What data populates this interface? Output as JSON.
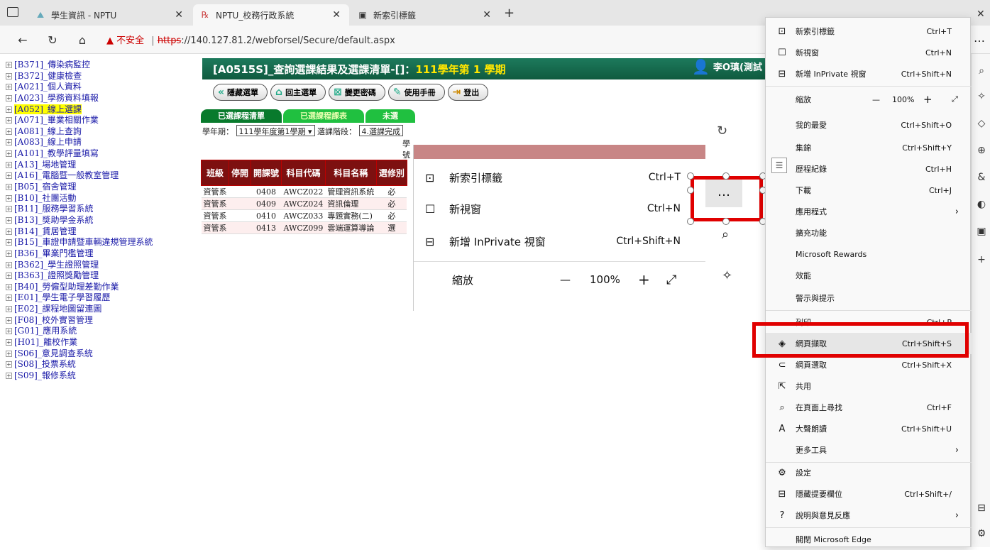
{
  "tabs": [
    {
      "label": "學生資訊 - NPTU",
      "icon": "⛰"
    },
    {
      "label": "NPTU_校務行政系統",
      "icon": "℞"
    },
    {
      "label": "新索引標籤",
      "icon": "▣"
    }
  ],
  "address": {
    "warning": "▲ 不安全",
    "sep": "|",
    "scheme": "https",
    "rest": "://140.127.81.2/webforsel/Secure/default.aspx"
  },
  "tree": [
    "[B371]_傳染病監控",
    "[B372]_健康檢查",
    "[A021]_個人資料",
    "[A023]_學務資料填報",
    "[A052]_線上選課",
    "[A071]_畢業相關作業",
    "[A081]_線上查詢",
    "[A083]_線上申請",
    "[A101]_教學評量填寫",
    "[A13]_場地管理",
    "[A16]_電腦暨一般教室管理",
    "[B05]_宿舍管理",
    "[B10]_社團活動",
    "[B11]_服務學習系統",
    "[B13]_獎助學金系統",
    "[B14]_賃居管理",
    "[B15]_車證申請暨車輛違規管理系統",
    "[B36]_畢業門檻管理",
    "[B362]_學生證照管理",
    "[B363]_證照獎勵管理",
    "[B40]_勞僱型助理差勤作業",
    "[E01]_學生電子學習履歷",
    "[E02]_課程地圖留連圖",
    "[F08]_校外實習管理",
    "[G01]_應用系統",
    "[H01]_離校作業",
    "[S06]_意見調查系統",
    "[S08]_投票系統",
    "[S09]_報修系統"
  ],
  "banner": {
    "title": "[A0515S]_查詢選課結果及選課清單-[]：",
    "semester": "111學年第 1 學期",
    "user": "李O瑱(測試"
  },
  "buttons": [
    "隱藏選單",
    "回主選單",
    "變更密碼",
    "使用手冊",
    "登出"
  ],
  "subtabs": [
    "已選課程清單",
    "已選課程課表",
    "未選"
  ],
  "filter": {
    "year_label": "學年期：",
    "year_value": "111學年度第1學期",
    "stage_label": "選課階段：",
    "stage_value": "4.選課完成",
    "extra": "學號"
  },
  "table": {
    "headers": [
      "班級",
      "停開",
      "開課號",
      "科目代碼",
      "科目名稱",
      "選修別"
    ],
    "rows": [
      [
        "資管系",
        "",
        "0408",
        "AWCZ022",
        "管理資訊系統",
        "必"
      ],
      [
        "資管系",
        "",
        "0409",
        "AWCZ024",
        "資訊倫理",
        "必"
      ],
      [
        "資管系",
        "",
        "0410",
        "AWCZ033",
        "專題實務(二)",
        "必"
      ],
      [
        "資管系",
        "",
        "0413",
        "AWCZ099",
        "雲端運算導論",
        "選"
      ]
    ]
  },
  "zoom_menu": {
    "rows": [
      {
        "icon": "⊡",
        "label": "新索引標籤",
        "shortcut": "Ctrl+T"
      },
      {
        "icon": "☐",
        "label": "新視窗",
        "shortcut": "Ctrl+N"
      },
      {
        "icon": "⊟",
        "label": "新增 InPrivate 視窗",
        "shortcut": "Ctrl+Shift+N"
      }
    ],
    "zoom_label": "縮放",
    "zoom_value": "100%",
    "minus": "—",
    "plus": "+",
    "expand": "⤢",
    "dots": "…"
  },
  "menu": {
    "items": [
      {
        "icon": "⊡",
        "label": "新索引標籤",
        "shortcut": "Ctrl+T"
      },
      {
        "icon": "☐",
        "label": "新視窗",
        "shortcut": "Ctrl+N"
      },
      {
        "icon": "⊟",
        "label": "新增 InPrivate 視窗",
        "shortcut": "Ctrl+Shift+N"
      },
      {
        "icon": "",
        "label": "縮放",
        "shortcut": ""
      },
      {
        "icon": "",
        "label": "我的最愛",
        "shortcut": "Ctrl+Shift+O"
      },
      {
        "icon": "",
        "label": "集錦",
        "shortcut": "Ctrl+Shift+Y"
      },
      {
        "icon": "",
        "label": "歷程紀錄",
        "shortcut": "Ctrl+H"
      },
      {
        "icon": "",
        "label": "下載",
        "shortcut": "Ctrl+J"
      },
      {
        "icon": "",
        "label": "應用程式",
        "shortcut": ""
      },
      {
        "icon": "",
        "label": "擴充功能",
        "shortcut": ""
      },
      {
        "icon": "",
        "label": "Microsoft Rewards",
        "shortcut": ""
      },
      {
        "icon": "",
        "label": "效能",
        "shortcut": ""
      },
      {
        "icon": "",
        "label": "警示與提示",
        "shortcut": ""
      },
      {
        "icon": "",
        "label": "列印",
        "shortcut": "Ctrl+P"
      },
      {
        "icon": "◈",
        "label": "網頁擷取",
        "shortcut": "Ctrl+Shift+S"
      },
      {
        "icon": "⊂",
        "label": "網頁選取",
        "shortcut": "Ctrl+Shift+X"
      },
      {
        "icon": "⇱",
        "label": "共用",
        "shortcut": ""
      },
      {
        "icon": "⌕",
        "label": "在頁面上尋找",
        "shortcut": "Ctrl+F"
      },
      {
        "icon": "A",
        "label": "大聲朗讀",
        "shortcut": "Ctrl+Shift+U"
      },
      {
        "icon": "",
        "label": "更多工具",
        "shortcut": ""
      },
      {
        "icon": "⚙",
        "label": "設定",
        "shortcut": ""
      },
      {
        "icon": "⊟",
        "label": "隱藏提要欄位",
        "shortcut": "Ctrl+Shift+/"
      },
      {
        "icon": "?",
        "label": "說明與意見反應",
        "shortcut": ""
      },
      {
        "icon": "",
        "label": "關閉 Microsoft Edge",
        "shortcut": ""
      }
    ],
    "zoom_value": "100%",
    "chevron": "›"
  }
}
